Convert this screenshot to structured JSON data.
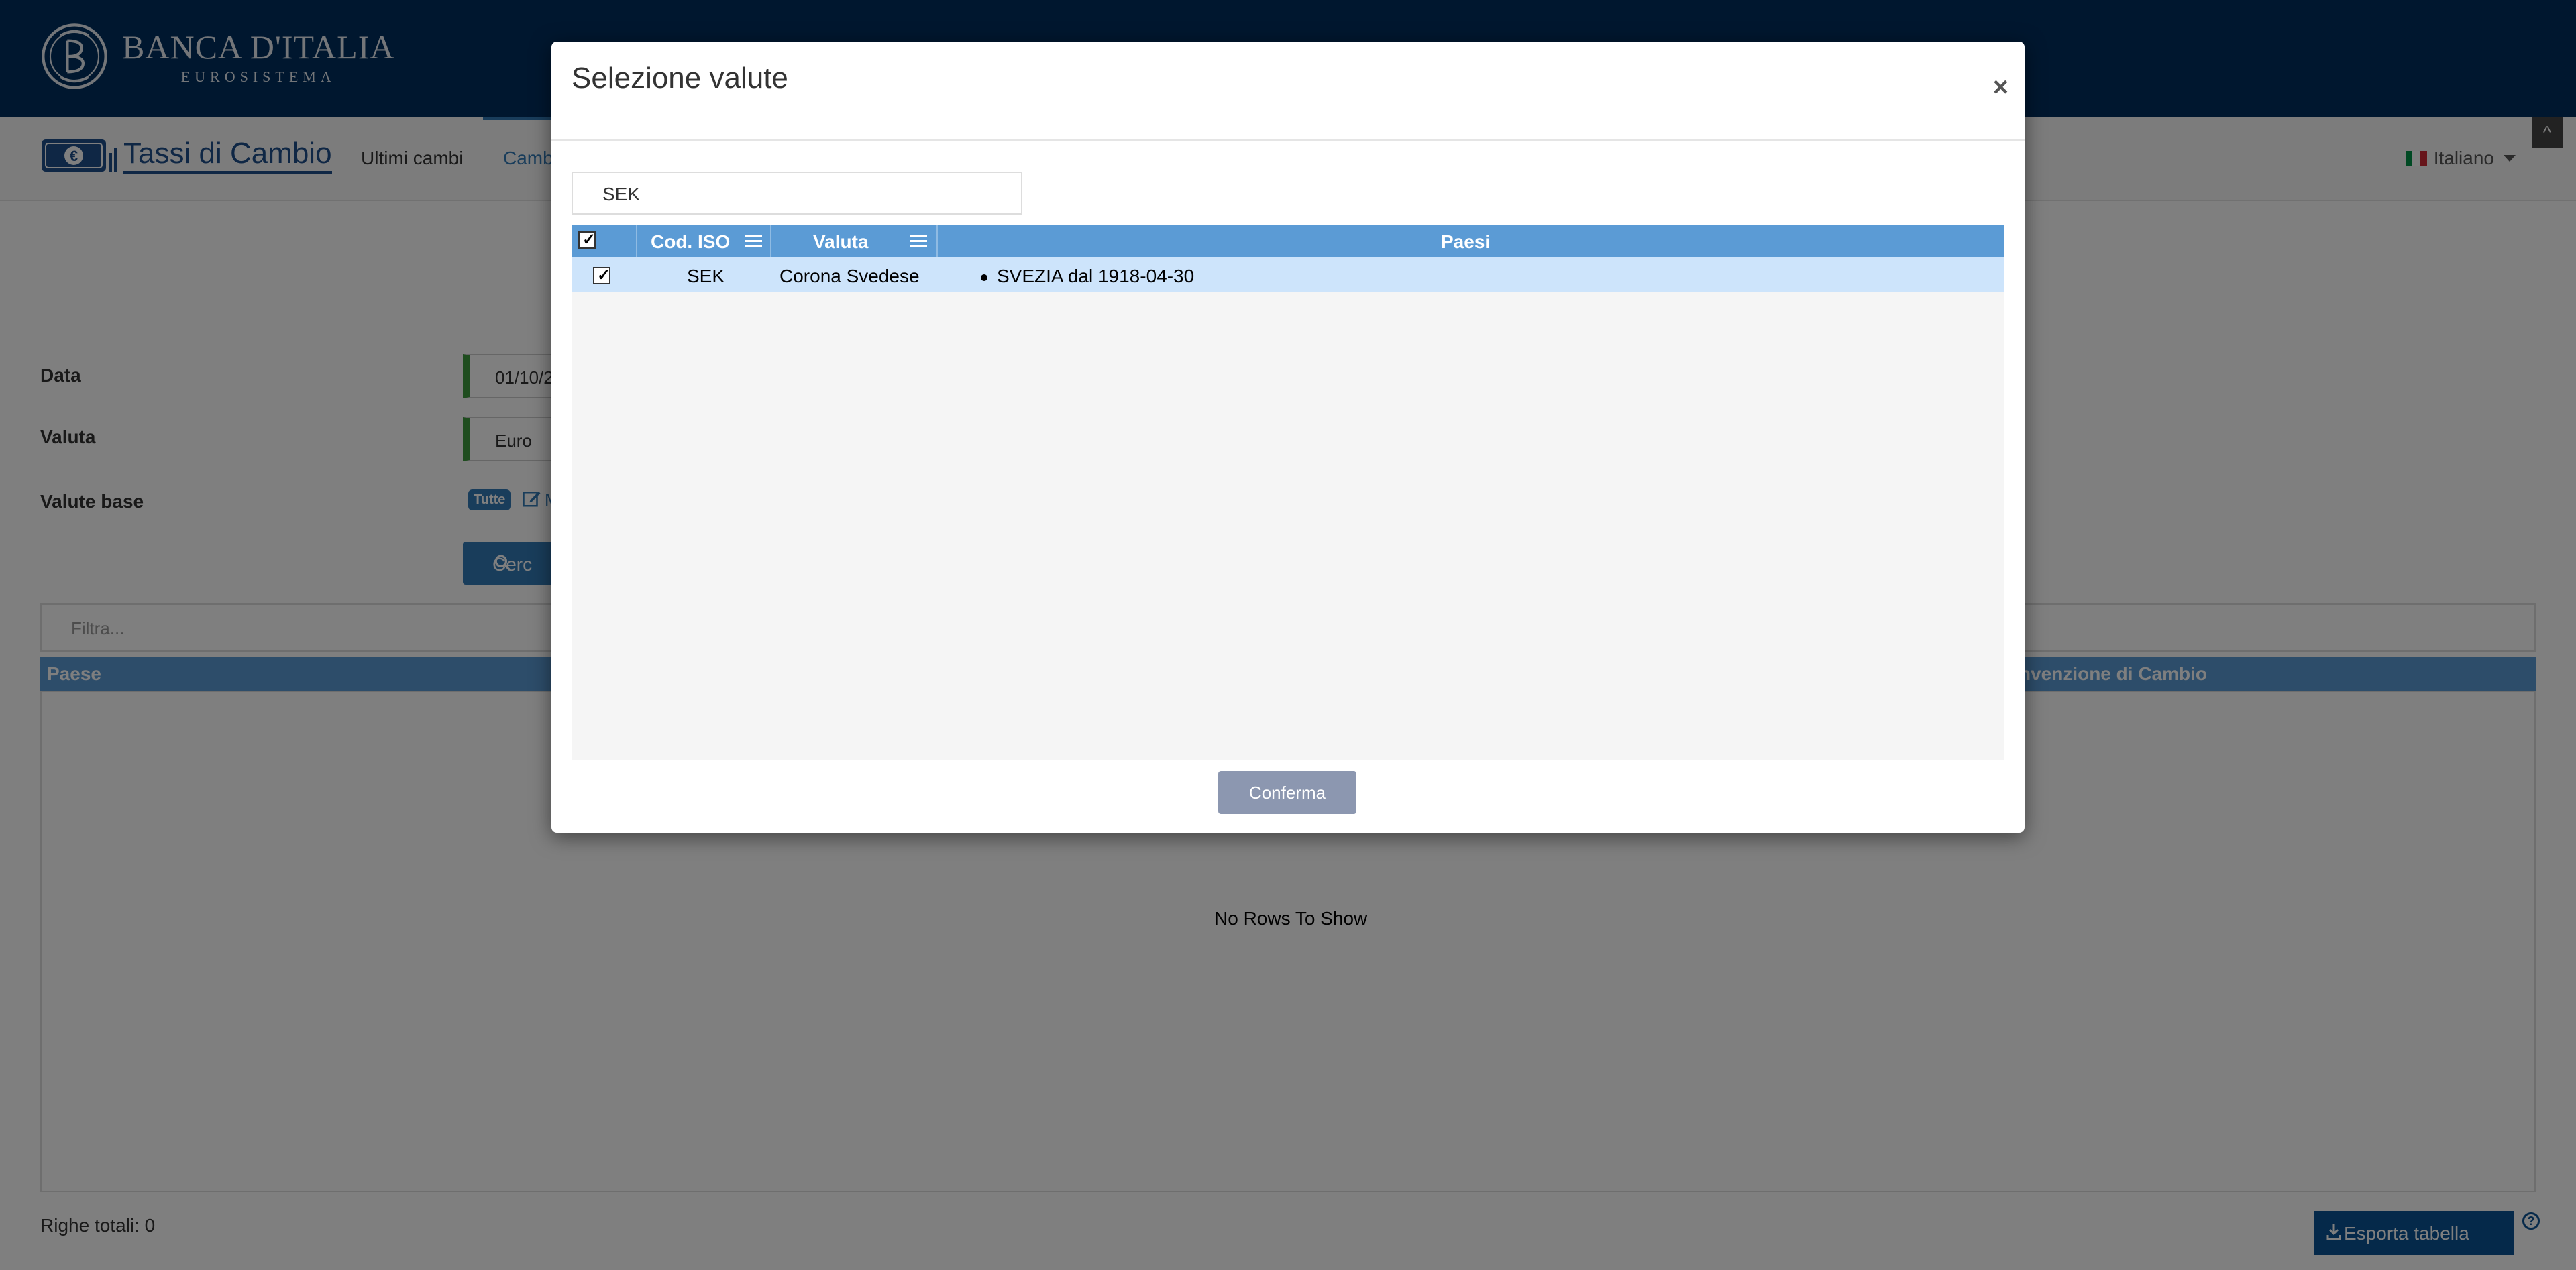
{
  "header": {
    "logo_title": "BANCA D'ITALIA",
    "logo_subtitle": "EUROSISTEMA"
  },
  "navbar": {
    "brand": "Tassi di Cambio",
    "items": [
      "Ultimi cambi",
      "Camb"
    ],
    "language": "Italiano"
  },
  "form": {
    "data_label": "Data",
    "data_value": "01/10/2",
    "valuta_label": "Valuta",
    "valuta_value": "Euro",
    "valute_base_label": "Valute base",
    "valute_base_badge": "Tutte",
    "valute_base_link": "M",
    "cerca_label": "Cerc"
  },
  "filter": {
    "placeholder": "Filtra..."
  },
  "results_table": {
    "col_paese": "Paese",
    "col_convenzione": "nvenzione di Cambio",
    "empty_message": "No Rows To Show"
  },
  "footer": {
    "total_rows": "Righe totali: 0",
    "export_label": "Esporta tabella",
    "help": "?"
  },
  "scroll_top": "^",
  "modal": {
    "title": "Selezione valute",
    "close": "×",
    "search_value": "SEK",
    "columns": [
      "Cod. ISO",
      "Valuta",
      "Paesi"
    ],
    "rows": [
      {
        "checked": true,
        "iso": "SEK",
        "valuta": "Corona Svedese",
        "paesi": "SVEZIA dal 1918-04-30"
      }
    ],
    "confirm_label": "Conferma"
  },
  "colors": {
    "header_navy": "#002f5f",
    "grid_header_blue": "#5b9bd5",
    "selected_row": "#cde4fb",
    "input_accent_green": "#3c9a3c",
    "confirm_gray": "#8c97b0",
    "export_blue": "#0b5394"
  },
  "icons": [
    "bank-emblem-icon",
    "currency-icon",
    "chevron-up-icon",
    "edit-icon",
    "search-icon",
    "download-icon",
    "help-icon",
    "menu-icon",
    "close-icon",
    "checkbox-icon",
    "italy-flag-icon"
  ]
}
